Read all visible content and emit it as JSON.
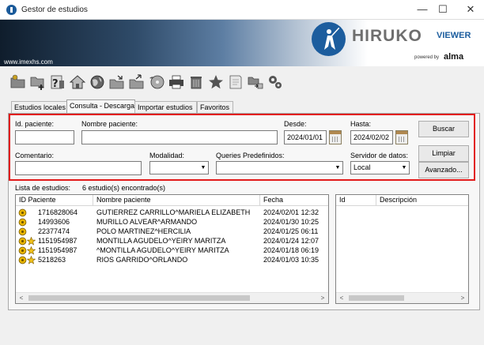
{
  "window": {
    "title": "Gestor de estudios",
    "minimize_glyph": "—",
    "maximize_glyph": "☐",
    "close_glyph": "✕"
  },
  "banner": {
    "url": "www.imexhs.com",
    "logo_name": "HIRUKO",
    "logo_suffix": "VIEWER",
    "powered_by": "powered by",
    "partner": "alma"
  },
  "toolbar": {
    "icons": [
      "open-folder-icon",
      "add-folder-icon",
      "search-study-icon",
      "home-icon",
      "globe-icon",
      "export-folder-icon",
      "import-folder-icon",
      "cd-burn-icon",
      "printer-icon",
      "trash-icon",
      "star-icon",
      "notes-icon",
      "transfer-icon",
      "settings-icon"
    ]
  },
  "tabs": [
    {
      "label": "Estudios locales",
      "active": false
    },
    {
      "label": "Consulta - Descarga",
      "active": true
    },
    {
      "label": "Importar estudios",
      "active": false
    },
    {
      "label": "Favoritos",
      "active": false
    }
  ],
  "search": {
    "id_label": "Id. paciente:",
    "id_value": "",
    "name_label": "Nombre paciente:",
    "name_value": "",
    "from_label": "Desde:",
    "from_value": "2024/01/01",
    "to_label": "Hasta:",
    "to_value": "2024/02/02",
    "comment_label": "Comentario:",
    "comment_value": "",
    "modality_label": "Modalidad:",
    "modality_value": "",
    "queries_label": "Queries Predefinidos:",
    "queries_value": "",
    "server_label": "Servidor de datos:",
    "server_value": "Local",
    "search_button": "Buscar",
    "clear_button": "Limpiar",
    "advanced_button": "Avanzado...",
    "dropdown_glyph": "▼"
  },
  "studies": {
    "list_label": "Lista de estudios:",
    "count_label": "6 estudio(s) encontrado(s)",
    "columns": [
      "ID Paciente",
      "Nombre paciente",
      "Fecha"
    ],
    "rows": [
      {
        "id": "1716828064",
        "name": "GUTIERREZ CARRILLO^MARIELA ELIZABETH",
        "date": "2024/02/01 12:32",
        "starred": false
      },
      {
        "id": "14993606",
        "name": "MURILLO ALVEAR^ARMANDO",
        "date": "2024/01/30 10:25",
        "starred": false
      },
      {
        "id": "22377474",
        "name": "POLO MARTINEZ^HERCILIA",
        "date": "2024/01/25 06:11",
        "starred": false
      },
      {
        "id": "1151954987",
        "name": "MONTILLA AGUDELO^YEIRY MARITZA",
        "date": "2024/01/24 12:07",
        "starred": true
      },
      {
        "id": "1151954987",
        "name": "^MONTILLA AGUDELO^YEIRY MARITZA",
        "date": "2024/01/18 06:19",
        "starred": true
      },
      {
        "id": "5218263",
        "name": "RIOS GARRIDO^ORLANDO",
        "date": "2024/01/03 10:35",
        "starred": true
      }
    ]
  },
  "details": {
    "columns": [
      "Id",
      "Descripción"
    ]
  },
  "scroll": {
    "left_glyph": "<",
    "right_glyph": ">"
  },
  "colors": {
    "highlight_border": "#e21b1b",
    "brand_blue": "#1c5d9e",
    "study_icon": "#e8b500",
    "star": "#f2c21b"
  }
}
